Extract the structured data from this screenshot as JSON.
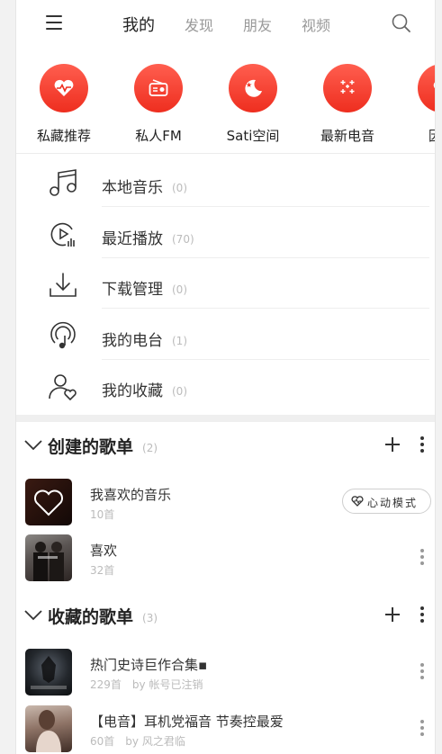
{
  "header": {
    "tabs": [
      {
        "label": "我的",
        "active": true
      },
      {
        "label": "发现",
        "active": false
      },
      {
        "label": "朋友",
        "active": false
      },
      {
        "label": "视频",
        "active": false
      }
    ],
    "menu_icon": "hamburger-menu-icon",
    "search_icon": "search-icon"
  },
  "quick_access": [
    {
      "label": "私藏推荐",
      "icon": "heart-pulse-icon"
    },
    {
      "label": "私人FM",
      "icon": "radio-icon"
    },
    {
      "label": "Sati空间",
      "icon": "moon-star-icon"
    },
    {
      "label": "最新电音",
      "icon": "sparkles-icon"
    },
    {
      "label": "因乐",
      "icon": "heart-icon"
    }
  ],
  "library": [
    {
      "label": "本地音乐",
      "count": "(0)",
      "icon": "music-note-icon"
    },
    {
      "label": "最近播放",
      "count": "(70)",
      "icon": "recent-play-icon"
    },
    {
      "label": "下载管理",
      "count": "(0)",
      "icon": "download-icon"
    },
    {
      "label": "我的电台",
      "count": "(1)",
      "icon": "podcast-icon"
    },
    {
      "label": "我的收藏",
      "count": "(0)",
      "icon": "user-heart-icon"
    }
  ],
  "created_playlists": {
    "title": "创建的歌单",
    "count": "(2)",
    "items": [
      {
        "title": "我喜欢的音乐",
        "sub": "10首",
        "by": ""
      },
      {
        "title": "喜欢",
        "sub": "32首",
        "by": ""
      }
    ],
    "heart_mode_label": "心动模式"
  },
  "collected_playlists": {
    "title": "收藏的歌单",
    "count": "(3)",
    "items": [
      {
        "title": "热门史诗巨作合集▪",
        "sub": "229首",
        "by": "by 帐号已注销"
      },
      {
        "title": "【电音】耳机党福音 节奏控最爱",
        "sub": "60首",
        "by": "by 风之君临"
      }
    ]
  },
  "colors": {
    "accent": "#ee2e1f",
    "text": "#333333",
    "muted": "#bbbbbb"
  }
}
